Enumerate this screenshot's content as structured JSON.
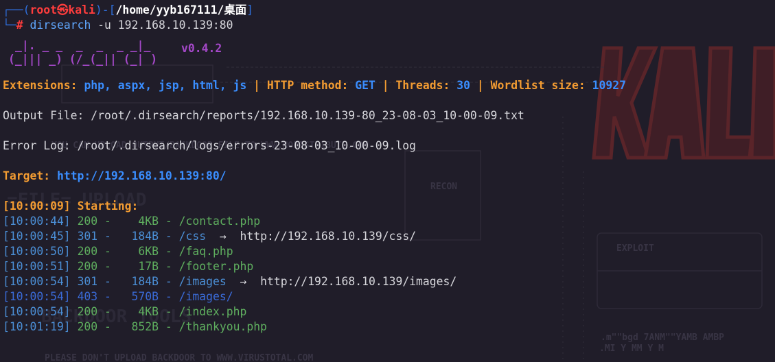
{
  "prompt": {
    "user": "root",
    "skull": "㉿",
    "host": "kali",
    "path": "/home/yyb167111/桌面",
    "hash": "#",
    "command": "dirsearch",
    "args": " -u 192.168.10.139:80"
  },
  "banner": {
    "line1": "_|. _ _  _  _  _ _|_",
    "line2": "(_||| _) (/_(_|| (_| )",
    "version": "v0.4.2"
  },
  "config": {
    "ext_label": "Extensions:",
    "ext_value": "php, aspx, jsp, html, js",
    "method_label": "HTTP method:",
    "method_value": "GET",
    "threads_label": "Threads:",
    "threads_value": "30",
    "wordlist_label": "Wordlist size:",
    "wordlist_value": "10927",
    "sep": "|"
  },
  "output_file": "Output File: /root/.dirsearch/reports/192.168.10.139-80_23-08-03_10-00-09.txt",
  "error_log": "Error Log: /root/.dirsearch/logs/errors-23-08-03_10-00-09.log",
  "target": {
    "label": "Target:",
    "url": "http://192.168.10.139:80/"
  },
  "start": {
    "time": "[10:00:09]",
    "text": "Starting:"
  },
  "results": [
    {
      "time": "[10:00:44]",
      "code": "200",
      "size": "   4KB",
      "path": "/contact.php",
      "redirect": ""
    },
    {
      "time": "[10:00:45]",
      "code": "301",
      "size": "  184B",
      "path": "/css",
      "redirect": "http://192.168.10.139/css/"
    },
    {
      "time": "[10:00:50]",
      "code": "200",
      "size": "   6KB",
      "path": "/faq.php",
      "redirect": ""
    },
    {
      "time": "[10:00:51]",
      "code": "200",
      "size": "   17B",
      "path": "/footer.php",
      "redirect": ""
    },
    {
      "time": "[10:00:54]",
      "code": "301",
      "size": "  184B",
      "path": "/images",
      "redirect": "http://192.168.10.139/images/"
    },
    {
      "time": "[10:00:54]",
      "code": "403",
      "size": "  570B",
      "path": "/images/",
      "redirect": ""
    },
    {
      "time": "[10:00:54]",
      "code": "200",
      "size": "   4KB",
      "path": "/index.php",
      "redirect": ""
    },
    {
      "time": "[10:01:19]",
      "code": "200",
      "size": "  852B",
      "path": "/thankyou.php",
      "redirect": ""
    }
  ],
  "arrow": "→",
  "dash": "-",
  "colors": {
    "background": "#201d29",
    "orange": "#f39c32",
    "blue": "#3a8eff",
    "green": "#62b46a",
    "purple": "#a448c8",
    "red": "#ff3d3d"
  }
}
